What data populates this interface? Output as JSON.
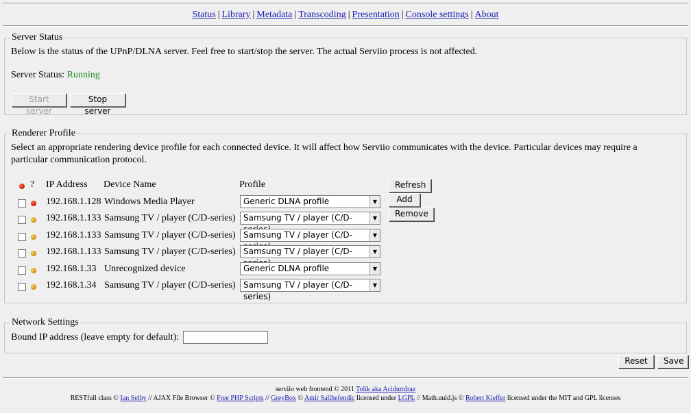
{
  "nav": {
    "items": [
      "Status",
      "Library",
      "Metadata",
      "Transcoding",
      "Presentation",
      "Console settings",
      "About"
    ],
    "separator": "|"
  },
  "server_status": {
    "legend": "Server Status",
    "description": "Below is the status of the UPnP/DLNA server. Feel free to start/stop the server.  The actual Serviio process is not affected.",
    "status_label": "Server Status:",
    "status_value": "Running",
    "start_label": "Start server",
    "stop_label": "Stop server"
  },
  "renderer": {
    "legend": "Renderer Profile",
    "description_line1": "Select an appropriate rendering device profile for each connected device. It will affect how Serviio communicates with the device. Particular devices may require a",
    "description_line2": "particular communication protocol.",
    "headers": {
      "question": "?",
      "ip": "IP Address",
      "device": "Device Name",
      "profile": "Profile"
    },
    "refresh_label": "Refresh",
    "add_label": "Add",
    "remove_label": "Remove",
    "rows": [
      {
        "ip": "192.168.1.128",
        "device": "Windows Media Player",
        "profile": "Generic DLNA profile",
        "status": "red",
        "checked": false
      },
      {
        "ip": "192.168.1.133",
        "device": "Samsung TV / player (C/D-series)",
        "profile": "Samsung TV / player (C/D-series)",
        "status": "amber",
        "checked": false
      },
      {
        "ip": "192.168.1.133",
        "device": "Samsung TV / player (C/D-series)",
        "profile": "Samsung TV / player (C/D-series)",
        "status": "amber",
        "checked": false
      },
      {
        "ip": "192.168.1.133",
        "device": "Samsung TV / player (C/D-series)",
        "profile": "Samsung TV / player (C/D-series)",
        "status": "amber",
        "checked": false
      },
      {
        "ip": "192.168.1.33",
        "device": "Unrecognized device",
        "profile": "Generic DLNA profile",
        "status": "amber",
        "checked": false
      },
      {
        "ip": "192.168.1.34",
        "device": "Samsung TV / player (C/D-series)",
        "profile": "Samsung TV / player (C/D-series)",
        "status": "amber",
        "checked": false
      }
    ]
  },
  "network": {
    "legend": "Network Settings",
    "bound_ip_label": "Bound IP address (leave empty for default):",
    "bound_ip_value": ""
  },
  "actions": {
    "reset_label": "Reset",
    "save_label": "Save"
  },
  "footer": {
    "line1_prefix": "serviio web frontend © 2011",
    "line1_link": "Tolik aka AcidumIrae",
    "line2": [
      {
        "t": "RESTfull class © ",
        "link": false
      },
      {
        "t": "Ian Selby",
        "link": true
      },
      {
        "t": " // AJAX File Browser © ",
        "link": false
      },
      {
        "t": "Free PHP Scripts",
        "link": true
      },
      {
        "t": " // ",
        "link": false
      },
      {
        "t": "GreyBox",
        "link": true
      },
      {
        "t": " © ",
        "link": false
      },
      {
        "t": "Amir Salihefendic",
        "link": true
      },
      {
        "t": " licensed under ",
        "link": false
      },
      {
        "t": "LGPL",
        "link": true
      },
      {
        "t": " // Math.uuid.js © ",
        "link": false
      },
      {
        "t": "Robert Kieffer",
        "link": true
      },
      {
        "t": " licensed under the MIT and GPL licenses",
        "link": false
      }
    ]
  },
  "colors": {
    "link": "#1a1ab4",
    "running": "#1b8a1b",
    "status_red": "#c01b00",
    "status_amber": "#c88a00"
  }
}
